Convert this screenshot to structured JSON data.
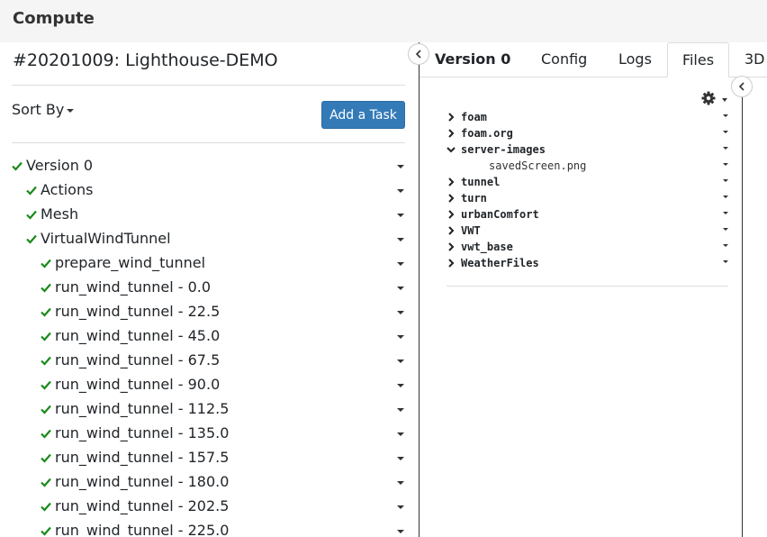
{
  "app": {
    "title": "Compute"
  },
  "job": {
    "title": "#20201009: Lighthouse-DEMO"
  },
  "toolbar": {
    "sort_label": "Sort By",
    "add_task_label": "Add a Task"
  },
  "tree": [
    {
      "label": "Version 0",
      "depth": 0
    },
    {
      "label": "Actions",
      "depth": 1
    },
    {
      "label": "Mesh",
      "depth": 1
    },
    {
      "label": "VirtualWindTunnel",
      "depth": 1
    },
    {
      "label": "prepare_wind_tunnel",
      "depth": 2
    },
    {
      "label": "run_wind_tunnel - 0.0",
      "depth": 2
    },
    {
      "label": "run_wind_tunnel - 22.5",
      "depth": 2
    },
    {
      "label": "run_wind_tunnel - 45.0",
      "depth": 2
    },
    {
      "label": "run_wind_tunnel - 67.5",
      "depth": 2
    },
    {
      "label": "run_wind_tunnel - 90.0",
      "depth": 2
    },
    {
      "label": "run_wind_tunnel - 112.5",
      "depth": 2
    },
    {
      "label": "run_wind_tunnel - 135.0",
      "depth": 2
    },
    {
      "label": "run_wind_tunnel - 157.5",
      "depth": 2
    },
    {
      "label": "run_wind_tunnel - 180.0",
      "depth": 2
    },
    {
      "label": "run_wind_tunnel - 202.5",
      "depth": 2
    },
    {
      "label": "run_wind_tunnel - 225.0",
      "depth": 2
    }
  ],
  "tabs": [
    {
      "label": "Version 0",
      "kind": "heading"
    },
    {
      "label": "Config"
    },
    {
      "label": "Logs"
    },
    {
      "label": "Files",
      "active": true
    },
    {
      "label": "3D"
    }
  ],
  "files": [
    {
      "name": "foam",
      "type": "folder",
      "expanded": false
    },
    {
      "name": "foam.org",
      "type": "folder",
      "expanded": false
    },
    {
      "name": "server-images",
      "type": "folder",
      "expanded": true
    },
    {
      "name": "savedScreen.png",
      "type": "file"
    },
    {
      "name": "tunnel",
      "type": "folder",
      "expanded": false
    },
    {
      "name": "turn",
      "type": "folder",
      "expanded": false
    },
    {
      "name": "urbanComfort",
      "type": "folder",
      "expanded": false
    },
    {
      "name": "VWT",
      "type": "folder",
      "expanded": false
    },
    {
      "name": "vwt_base",
      "type": "folder",
      "expanded": false
    },
    {
      "name": "WeatherFiles",
      "type": "folder",
      "expanded": false
    }
  ],
  "icons": {
    "check": "check-icon",
    "gear": "gear-icon",
    "collapse": "chevron-left-icon",
    "chevron_right": "chevron-right-icon",
    "chevron_down": "chevron-down-icon"
  },
  "colors": {
    "success": "#1a8a1a",
    "primary": "#337ab7",
    "topbar": "#f5f5f5"
  }
}
